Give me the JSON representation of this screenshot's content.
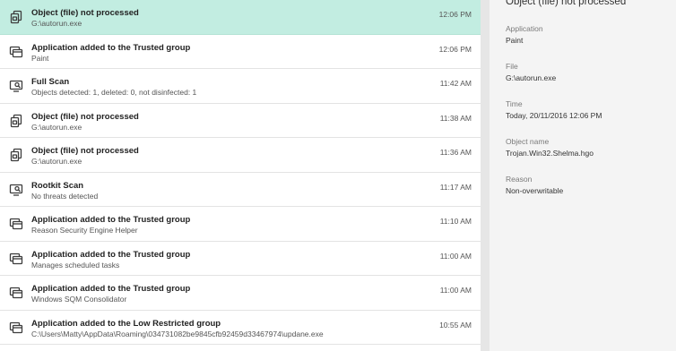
{
  "events": [
    {
      "icon": "file-not-processed-icon",
      "title": "Object (file) not processed",
      "sub": "G:\\autorun.exe",
      "time": "12:06 PM",
      "selected": true
    },
    {
      "icon": "trusted-app-icon",
      "title": "Application added to the Trusted group",
      "sub": "Paint",
      "time": "12:06 PM"
    },
    {
      "icon": "scan-monitor-icon",
      "title": "Full Scan",
      "sub": "Objects detected: 1, deleted: 0, not disinfected: 1",
      "time": "11:42 AM"
    },
    {
      "icon": "file-not-processed-icon",
      "title": "Object (file) not processed",
      "sub": "G:\\autorun.exe",
      "time": "11:38 AM"
    },
    {
      "icon": "file-not-processed-icon",
      "title": "Object (file) not processed",
      "sub": "G:\\autorun.exe",
      "time": "11:36 AM"
    },
    {
      "icon": "scan-monitor-icon",
      "title": "Rootkit Scan",
      "sub": "No threats detected",
      "time": "11:17 AM"
    },
    {
      "icon": "trusted-app-icon",
      "title": "Application added to the Trusted group",
      "sub": "Reason Security Engine Helper",
      "time": "11:10 AM"
    },
    {
      "icon": "trusted-app-icon",
      "title": "Application added to the Trusted group",
      "sub": "Manages scheduled tasks",
      "time": "11:00 AM"
    },
    {
      "icon": "trusted-app-icon",
      "title": "Application added to the Trusted group",
      "sub": "Windows SQM Consolidator",
      "time": "11:00 AM"
    },
    {
      "icon": "trusted-app-icon",
      "title": "Application added to the Low Restricted group",
      "sub": "C:\\Users\\Matty\\AppData\\Roaming\\034731082be9845cfb92459d33467974\\updane.exe",
      "time": "10:55 AM"
    }
  ],
  "details": {
    "title": "Object (file) not processed",
    "application_label": "Application",
    "application_value": "Paint",
    "file_label": "File",
    "file_value": "G:\\autorun.exe",
    "time_label": "Time",
    "time_value": "Today, 20/11/2016 12:06 PM",
    "object_label": "Object name",
    "object_value": "Trojan.Win32.Shelma.hgo",
    "reason_label": "Reason",
    "reason_value": "Non-overwritable"
  },
  "colors": {
    "selected_row": "#c2ede1",
    "icon_stroke": "#3c3c3c",
    "details_bg": "#f4f4f4"
  }
}
